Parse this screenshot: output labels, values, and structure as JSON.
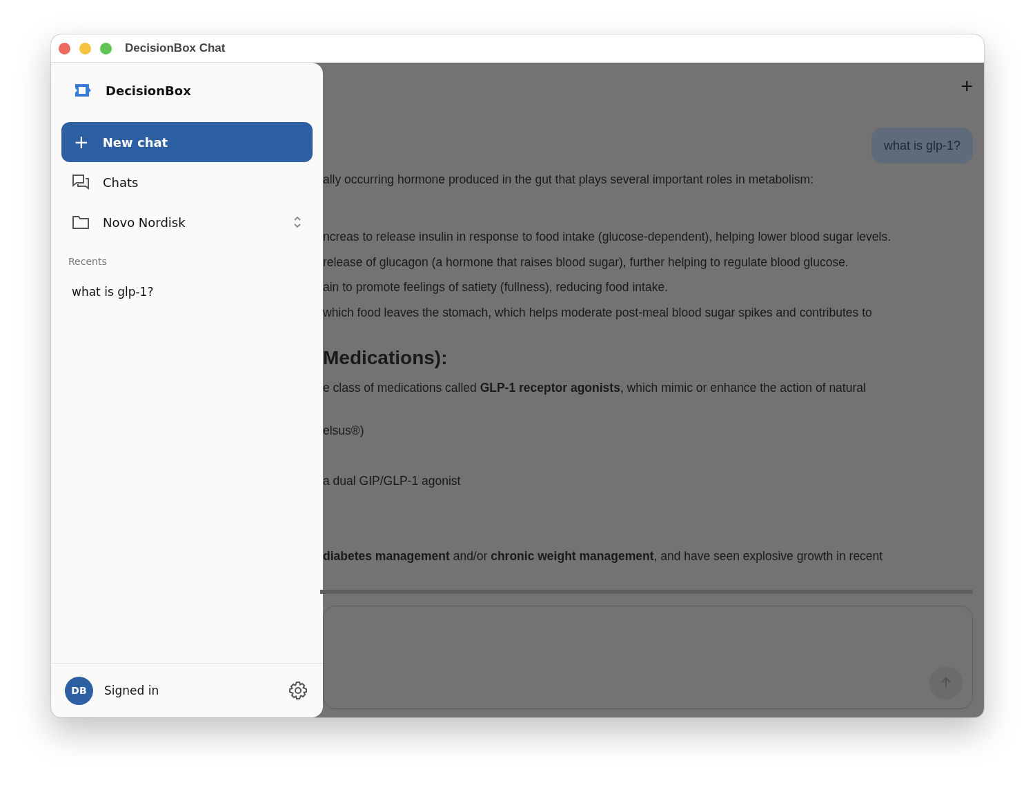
{
  "window": {
    "title": "DecisionBox Chat"
  },
  "sidebar": {
    "brand": "DecisionBox",
    "new_chat": {
      "icon": "+",
      "label": "New chat"
    },
    "nav": [
      {
        "kind": "chats",
        "label": "Chats",
        "expandable": false
      },
      {
        "kind": "folder",
        "label": "Novo Nordisk",
        "expandable": true
      }
    ],
    "recents_heading": "Recents",
    "recents": [
      {
        "label": "what is glp-1?",
        "selected": false
      }
    ],
    "footer": {
      "avatar": "DB",
      "status": "Signed in"
    }
  },
  "main": {
    "new_chat_icon": "+",
    "user_message": "what is glp-1?",
    "response": [
      {
        "kind": "text",
        "text": "ally occurring hormone produced in the gut that plays several important roles in metabolism:"
      },
      {
        "kind": "text",
        "text": "ncreas to release insulin in response to food intake (glucose-dependent), helping lower blood sugar levels."
      },
      {
        "kind": "text",
        "text": "release of glucagon (a hormone that raises blood sugar), further helping to regulate blood glucose."
      },
      {
        "kind": "text",
        "text": "ain to promote feelings of satiety (fullness), reducing food intake."
      },
      {
        "kind": "text",
        "text": "which food leaves the stomach, which helps moderate post-meal blood sugar spikes and contributes to"
      },
      {
        "kind": "heading",
        "text": "Medications):"
      },
      {
        "kind": "text",
        "text": "e class of medications called **GLP-1 receptor agonists**, which mimic or enhance the action of natural"
      },
      {
        "kind": "text",
        "text": "elsus®)"
      },
      {
        "kind": "text",
        "text": "a dual GIP/GLP-1 agonist"
      },
      {
        "kind": "text",
        "text": "**diabetes management** and/or **chronic weight management**, and have seen explosive growth in recent"
      }
    ]
  }
}
